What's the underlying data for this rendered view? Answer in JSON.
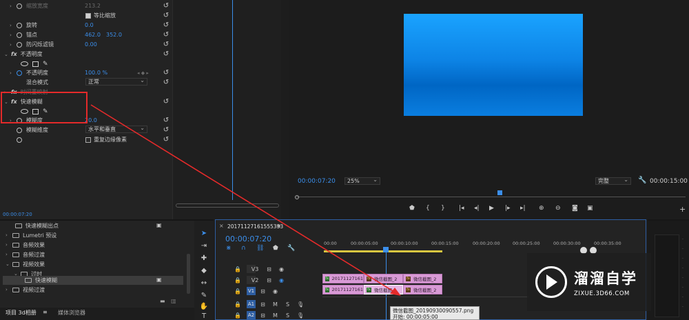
{
  "effect_controls": {
    "rows": [
      {
        "label": "缩放宽度",
        "value": "213.2"
      },
      {
        "label": "等比缩放"
      },
      {
        "label": "旋转",
        "value": "0.0"
      },
      {
        "label": "锚点",
        "value": "462.0",
        "value2": "352.0"
      },
      {
        "label": "防闪烁滤镜",
        "value": "0.00"
      },
      {
        "label": "不透明度",
        "fx": "fx"
      },
      {
        "label": "不透明度",
        "value": "100.0 %"
      },
      {
        "label": "混合模式",
        "value": "正常"
      },
      {
        "label": "时间重映射",
        "fx": "fx"
      },
      {
        "label": "快速模糊",
        "fx": "fx"
      },
      {
        "label": "模糊度",
        "value": "20.0"
      },
      {
        "label": "模糊维度",
        "value": "水平和垂直"
      },
      {
        "label": "重复边缘像素"
      }
    ],
    "timecode": "00:00:07:20"
  },
  "program_monitor": {
    "timecode": "00:00:07:20",
    "zoom": "25%",
    "quality": "完整",
    "duration": "00:00:15:00"
  },
  "project_panel": {
    "items": [
      {
        "label": "快速模糊出点"
      },
      {
        "label": "Lumetri 预设"
      },
      {
        "label": "音频效果"
      },
      {
        "label": "音频过渡"
      },
      {
        "label": "视频效果"
      },
      {
        "label": "过时"
      },
      {
        "label": "快速模糊"
      },
      {
        "label": "视频过渡"
      }
    ],
    "tabs": [
      {
        "label": "项目 3d相册"
      },
      {
        "label": "媒体浏览器"
      }
    ]
  },
  "timeline": {
    "sequence_name": "20171127161555333",
    "timecode": "00:00:07:20",
    "ruler": [
      "00:00",
      "00:00:05:00",
      "00:00:10:00",
      "00:00:15:00",
      "00:00:20:00",
      "00:00:25:00",
      "00:00:30:00",
      "00:00:35:00"
    ],
    "tracks": [
      {
        "name": "V3",
        "type": "video"
      },
      {
        "name": "V2",
        "type": "video"
      },
      {
        "name": "V1",
        "type": "video"
      },
      {
        "name": "A1",
        "type": "audio"
      },
      {
        "name": "A2",
        "type": "audio"
      }
    ],
    "clips": {
      "v2_a": "20171127161",
      "v2_b": "微信截图_2",
      "v2_c": "微信截图_2",
      "v1_a": "20171127161",
      "v1_b": "微信截图",
      "v1_c": "微信截图_2"
    },
    "tooltip_name": "微信截图_20190930090557.png",
    "tooltip_start": "开始: 00:00:05:00"
  },
  "watermark": {
    "title": "溜溜自学",
    "url": "ZIXUE.3D66.COM"
  },
  "colors": {
    "accent_blue": "#3b8eea",
    "annotation_red": "#e52a2a",
    "clip_pink": "#d99ad6"
  }
}
